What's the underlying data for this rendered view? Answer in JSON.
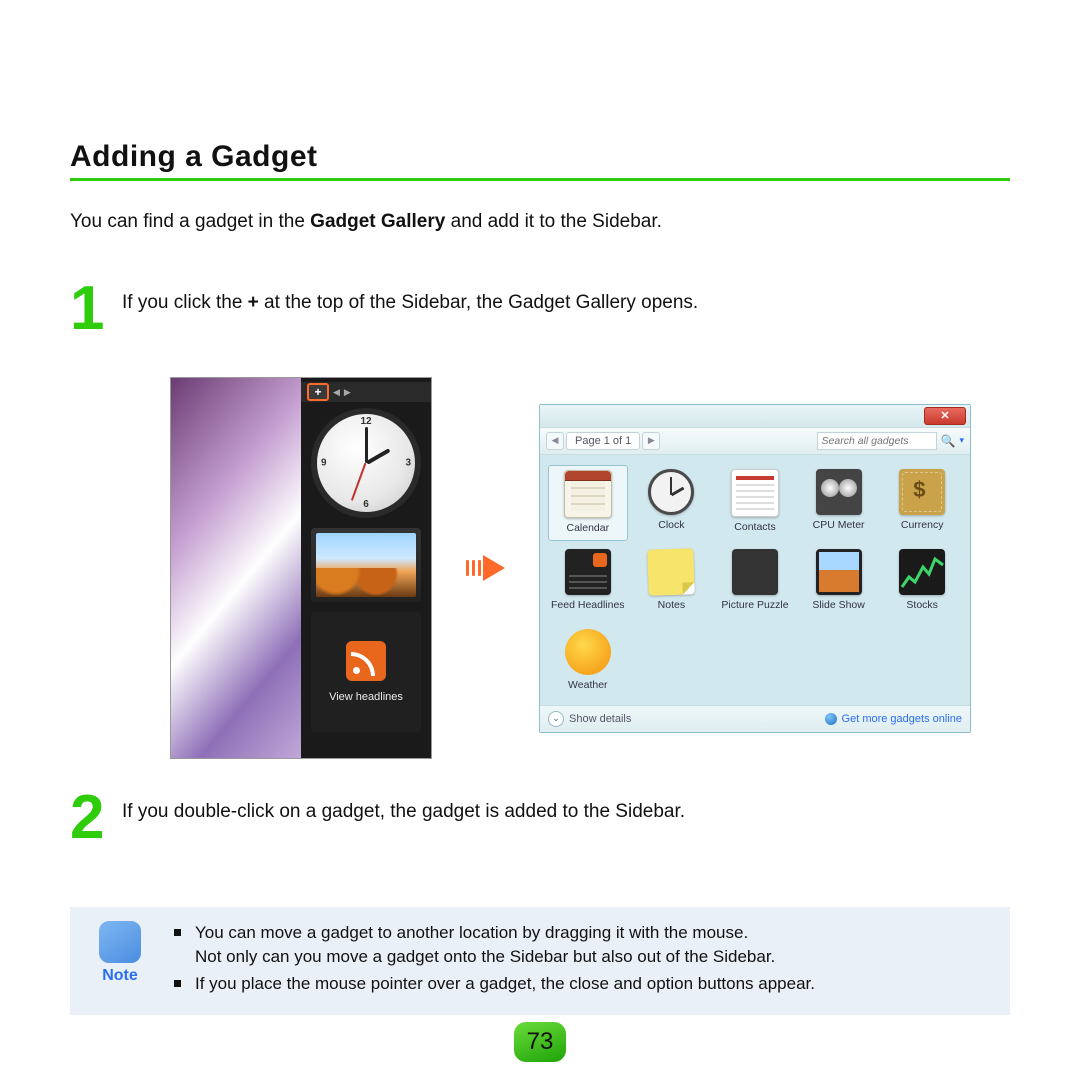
{
  "title": "Adding a Gadget",
  "intro_prefix": "You can find a gadget in the ",
  "intro_bold": "Gadget Gallery",
  "intro_suffix": " and add it to the Sidebar.",
  "step1": {
    "num": "1",
    "prefix": "If you click the ",
    "bold": "+",
    "suffix": " at the top of the Sidebar, the Gadget Gallery opens."
  },
  "step2": {
    "num": "2",
    "text": "If you double-click on a gadget, the gadget is added to the Sidebar."
  },
  "sidebar": {
    "plus": "+",
    "arrow_left": "◀",
    "arrow_right": "▶",
    "feed_label": "View headlines",
    "clock_ticks": {
      "t12": "12",
      "t3": "3",
      "t6": "6",
      "t9": "9"
    }
  },
  "gallery": {
    "close": "✕",
    "pager_prev": "◀",
    "pager_label": "Page 1 of 1",
    "pager_next": "▶",
    "search_placeholder": "Search all gadgets",
    "search_glass": "🔍",
    "search_dd": "▾",
    "show_details_chevron": "⌄",
    "show_details": "Show details",
    "more_online": "Get more gadgets online",
    "tiles": {
      "calendar": "Calendar",
      "clock": "Clock",
      "contacts": "Contacts",
      "cpu": "CPU Meter",
      "currency": "Currency",
      "feed": "Feed Headlines",
      "notes": "Notes",
      "puzzle": "Picture Puzzle",
      "slideshow": "Slide Show",
      "stocks": "Stocks",
      "weather": "Weather"
    }
  },
  "note": {
    "label": "Note",
    "item1_line1": "You can move a gadget to another location by dragging it with the mouse.",
    "item1_line2": "Not only can you move a gadget onto the Sidebar but also out of the Sidebar.",
    "item2": "If you place the mouse pointer over a gadget, the close and option buttons appear."
  },
  "page_number": "73"
}
